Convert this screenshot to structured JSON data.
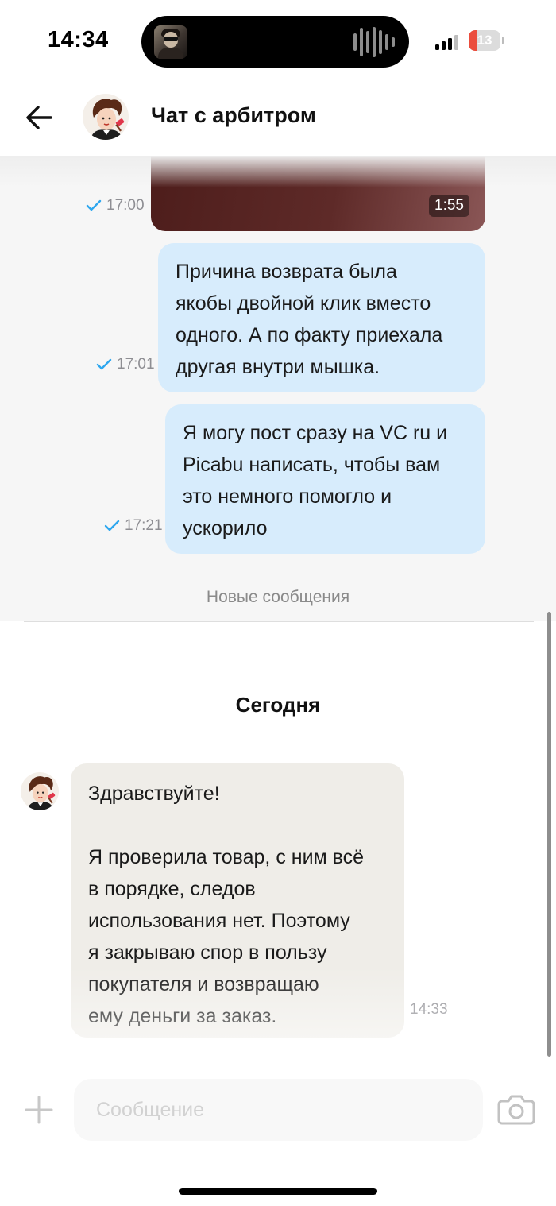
{
  "status_bar": {
    "time": "14:34",
    "battery_level": "13",
    "battery_fraction": 0.13,
    "icons": [
      "now-playing-artwork-icon",
      "waveform-icon",
      "cellular-signal-icon",
      "battery-charging-icon"
    ]
  },
  "header": {
    "title": "Чат с арбитром",
    "back_icon": "arrow-left-icon",
    "avatar": "arbiter-avatar"
  },
  "messages": [
    {
      "type": "video",
      "direction": "outgoing",
      "duration": "1:55",
      "time": "17:00",
      "read": true
    },
    {
      "type": "text",
      "direction": "outgoing",
      "time": "17:01",
      "read": true,
      "lines": [
        "Причина возврата была",
        "якобы двойной клик вместо",
        "одного. А по факту приехала",
        "другая внутри мышка."
      ]
    },
    {
      "type": "text",
      "direction": "outgoing",
      "time": "17:21",
      "read": true,
      "lines": [
        "Я могу пост сразу на VC ru и",
        "Picabu написать, чтобы вам",
        "это немного помогло и",
        "ускорило"
      ]
    }
  ],
  "separator": {
    "new_messages_label": "Новые сообщения"
  },
  "date_label": "Сегодня",
  "incoming": {
    "time": "14:33",
    "lines": [
      "Здравствуйте!",
      "",
      "Я проверила товар, с ним всё",
      "в порядке, следов",
      "использования нет. Поэтому",
      "я закрываю спор в пользу",
      "покупателя и возвращаю",
      "ему деньги за заказ."
    ]
  },
  "input": {
    "placeholder": "Сообщение",
    "value": "",
    "attach_icon": "plus-icon",
    "camera_icon": "camera-icon"
  },
  "colors": {
    "outgoing_bubble": "#d7ecfc",
    "incoming_bubble": "#efede8",
    "read_check": "#2ea7ef",
    "battery_low": "#eb4d3d"
  }
}
